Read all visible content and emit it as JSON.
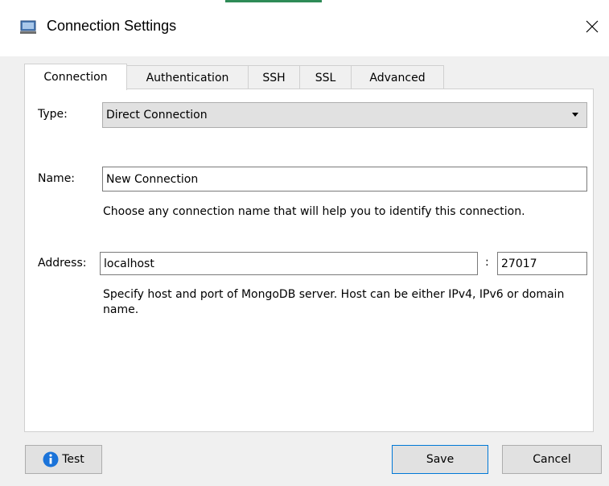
{
  "window": {
    "title": "Connection Settings",
    "close_glyph": "✕"
  },
  "tabs": [
    {
      "label": "Connection",
      "active": true
    },
    {
      "label": "Authentication",
      "active": false
    },
    {
      "label": "SSH",
      "active": false
    },
    {
      "label": "SSL",
      "active": false
    },
    {
      "label": "Advanced",
      "active": false
    }
  ],
  "form": {
    "type_label": "Type:",
    "type_value": "Direct Connection",
    "name_label": "Name:",
    "name_value": "New Connection",
    "name_help": "Choose any connection name that will help you to identify this connection.",
    "address_label": "Address:",
    "host_value": "localhost",
    "port_separator": ":",
    "port_value": "27017",
    "address_help": "Specify host and port of MongoDB server. Host can be either IPv4, IPv6 or domain name."
  },
  "buttons": {
    "test": "Test",
    "save": "Save",
    "cancel": "Cancel"
  },
  "icons": {
    "app": "computer-monitor-icon",
    "close": "close-icon",
    "info": "info-icon",
    "dropdown": "chevron-down-icon"
  },
  "colors": {
    "accent_bar": "#2e8b57",
    "info_blue": "#1a73d9",
    "focus_border": "#0078d7"
  }
}
